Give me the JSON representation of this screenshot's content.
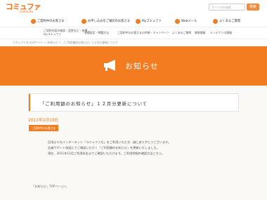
{
  "header": {
    "logo_main": "コミュファ",
    "logo_sub": "commufa",
    "search_placeholder": "サイト内を検索",
    "search_button": "検索"
  },
  "topnav": [
    {
      "label": "ご契約中のお客さま",
      "color": "#f37b20"
    },
    {
      "label": "お申し込みをご検討のお客さま",
      "color": "#f37b20"
    },
    {
      "label": "Myコミュファ",
      "color": "#f37b20"
    },
    {
      "label": "Webメール",
      "color": "#f37b20"
    },
    {
      "label": "よくあるご質問",
      "color": "#f37b20"
    }
  ],
  "subnav": {
    "item1_line1": "ご契約内容の確認・変更など・各種",
    "item1_line2": "Myコミュファ",
    "item2": "各種設定・問題方法",
    "item3": "ご契約中のお客さまの特典・キャンペーン",
    "item4": "よくあるご質問",
    "item5": "障害情報",
    "item6": "メンテナンス情報"
  },
  "breadcrumb": "コミュファ光 公式サイト ＞ お知らせ ＞ 「ご利用額のお知らせ」１２月分更新について",
  "banner": {
    "title": "お知らせ",
    "bg_color": "#f37b20"
  },
  "notice": {
    "title": "「ご利用額のお知らせ」１２月分更新について",
    "date": "2012年1月10日",
    "tag": "ご契約中のお客さま",
    "body": [
      "目頃より光インターネット「コミュファ光」をご利用いただき、誠にありがとうございます。",
      "会員サポート画面にてご確認いただく「ご利用額のお知らせ」を更新いたしました。",
      "現在、2011年12月ご利用料金までご確認いただけます。ご利用明細の確認方法こちら。"
    ],
    "back_link": "「お知らせ」TOPページへ"
  }
}
